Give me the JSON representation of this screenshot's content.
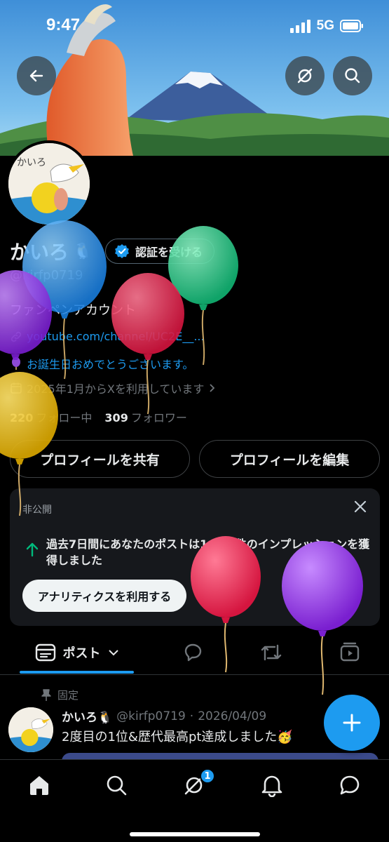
{
  "status_bar": {
    "time": "9:47",
    "network": "5G"
  },
  "profile": {
    "name": "かいろ",
    "name_emoji": "🐧",
    "verify_label": "認証を受ける",
    "handle": "@kirfp0719",
    "bio": "ファンペンアカウント",
    "link": "youtube.com/channel/UC2E__...",
    "birthday_text": "お誕生日おめでとうございます。",
    "joined_text": "2025年1月からXを利用しています",
    "following_count": "220",
    "following_label": "フォロー中",
    "followers_count": "309",
    "followers_label": "フォロワー"
  },
  "actions": {
    "share_label": "プロフィールを共有",
    "edit_label": "プロフィールを編集"
  },
  "analytics_card": {
    "label": "非公開",
    "message": "過去7日間にあなたのポストは1,718件のインプレッションを獲得しました",
    "button_label": "アナリティクスを利用する"
  },
  "tabs": {
    "posts_label": "ポスト"
  },
  "pinned_post": {
    "pinned_label": "固定",
    "author_name": "かいろ🐧",
    "author_handle": "@kirfp0719",
    "separator": "·",
    "date": "2026/04/09",
    "text": "2度目の1位&歴代最高pt達成しました🥳"
  },
  "bottom_nav": {
    "notification_badge": "1"
  },
  "colors": {
    "accent": "#1d9bf0",
    "background": "#000000"
  },
  "icons": [
    "back-arrow-icon",
    "grok-icon",
    "search-icon",
    "verified-badge-icon",
    "link-icon",
    "balloon-icon",
    "calendar-icon",
    "close-icon",
    "trend-up-arrow-icon",
    "post-feed-icon",
    "reply-icon",
    "repost-icon",
    "media-icon",
    "pin-icon",
    "plus-icon",
    "home-icon",
    "notification-bell-icon",
    "messages-icon"
  ]
}
